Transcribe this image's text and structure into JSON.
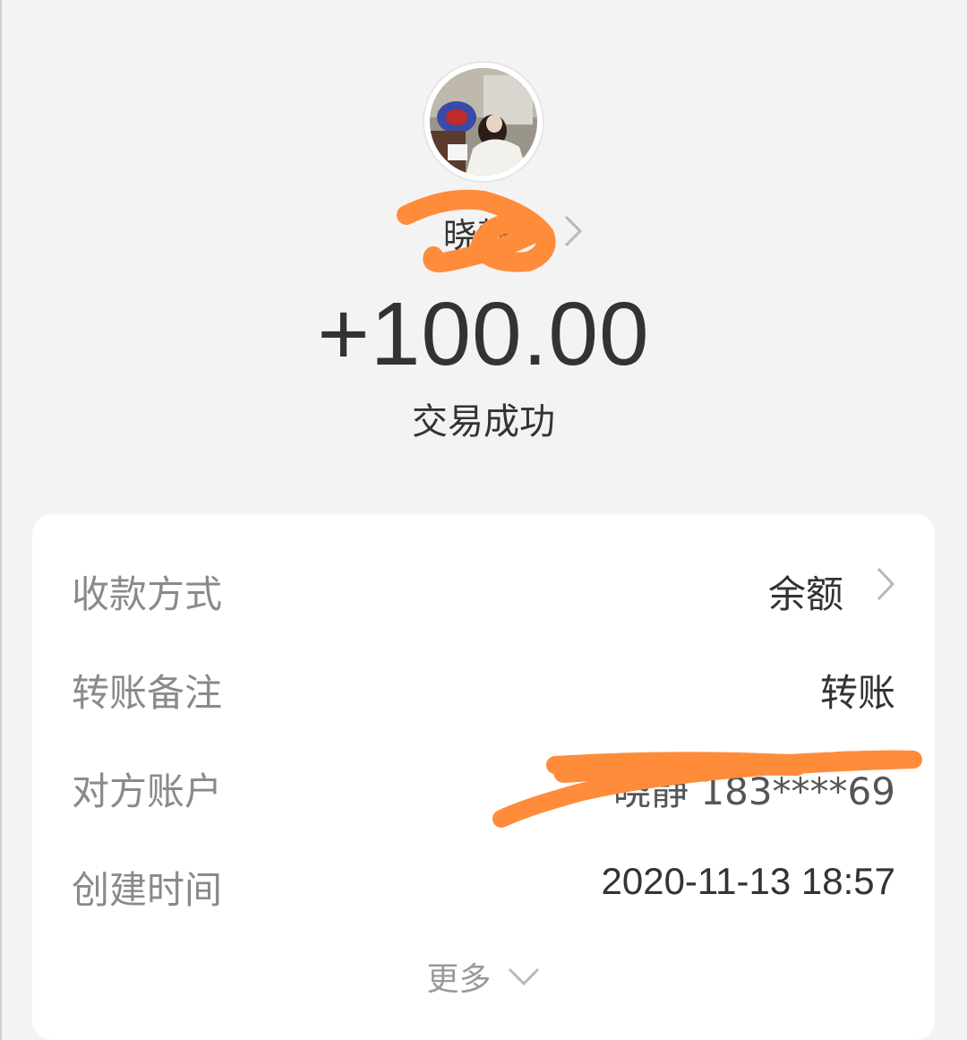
{
  "header": {
    "amount": "+100.00",
    "status": "交易成功",
    "name_partial": "晓静"
  },
  "details": {
    "rows": [
      {
        "label": "收款方式",
        "value": "余额"
      },
      {
        "label": "转账备注",
        "value": "转账"
      },
      {
        "label": "对方账户",
        "value": "晓静 183****69"
      },
      {
        "label": "创建时间",
        "value": "2020-11-13 18:57"
      }
    ],
    "more_label": "更多"
  },
  "colors": {
    "background": "#f3f3f3",
    "card": "#ffffff",
    "scribble": "#ff8c3a",
    "text_primary": "#333333",
    "text_secondary": "#8a8a8a"
  }
}
